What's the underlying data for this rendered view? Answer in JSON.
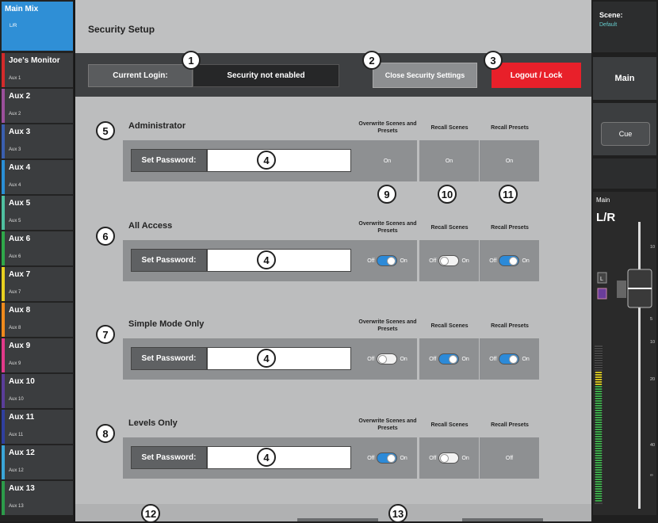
{
  "sidebar": {
    "header": {
      "title": "Main Mix",
      "subtitle": "L/R"
    },
    "items": [
      {
        "name": "Joe's Monitor",
        "sub": "Aux 1",
        "color": "#d42b2b"
      },
      {
        "name": "Aux 2",
        "sub": "Aux 2",
        "color": "#9b4f9b"
      },
      {
        "name": "Aux 3",
        "sub": "Aux 3",
        "color": "#3a5fb0"
      },
      {
        "name": "Aux 4",
        "sub": "Aux 4",
        "color": "#2a8fd6"
      },
      {
        "name": "Aux 5",
        "sub": "Aux 5",
        "color": "#4fc0a0"
      },
      {
        "name": "Aux 6",
        "sub": "Aux 6",
        "color": "#2fa84a"
      },
      {
        "name": "Aux 7",
        "sub": "Aux 7",
        "color": "#e8d020"
      },
      {
        "name": "Aux 8",
        "sub": "Aux 8",
        "color": "#f08a1c"
      },
      {
        "name": "Aux 9",
        "sub": "Aux 9",
        "color": "#e23a8a"
      },
      {
        "name": "Aux 10",
        "sub": "Aux 10",
        "color": "#5a3d9a"
      },
      {
        "name": "Aux 11",
        "sub": "Aux 11",
        "color": "#2f3f9f"
      },
      {
        "name": "Aux 12",
        "sub": "Aux 12",
        "color": "#3aa6d8"
      },
      {
        "name": "Aux 13",
        "sub": "Aux 13",
        "color": "#2c9b4a"
      }
    ]
  },
  "header": {
    "title": "Security Setup"
  },
  "login": {
    "label": "Current Login:",
    "value": "Security not enabled",
    "close_button": "Close Security Settings",
    "logout_button": "Logout / Lock"
  },
  "columns": [
    "Overwrite Scenes and Presets",
    "Recall Scenes",
    "Recall Presets"
  ],
  "sections": [
    {
      "title": "Administrator",
      "password_label": "Set Password:",
      "perms": [
        {
          "type": "text",
          "value": "On"
        },
        {
          "type": "text",
          "value": "On"
        },
        {
          "type": "text",
          "value": "On"
        }
      ]
    },
    {
      "title": "All Access",
      "password_label": "Set Password:",
      "perms": [
        {
          "type": "toggle",
          "state": "on"
        },
        {
          "type": "toggle",
          "state": "off"
        },
        {
          "type": "toggle",
          "state": "on"
        }
      ]
    },
    {
      "title": "Simple Mode Only",
      "password_label": "Set Password:",
      "perms": [
        {
          "type": "toggle",
          "state": "off"
        },
        {
          "type": "toggle",
          "state": "on"
        },
        {
          "type": "toggle",
          "state": "on"
        }
      ]
    },
    {
      "title": "Levels Only",
      "password_label": "Set Password:",
      "perms": [
        {
          "type": "toggle",
          "state": "on"
        },
        {
          "type": "toggle",
          "state": "off"
        },
        {
          "type": "text",
          "value": "Off"
        }
      ]
    }
  ],
  "toggle_labels": {
    "off": "Off",
    "on": "On"
  },
  "callouts": {
    "c1": "1",
    "c2": "2",
    "c3": "3",
    "c4": "4",
    "c5": "5",
    "c6": "6",
    "c7": "7",
    "c8": "8",
    "c9": "9",
    "c10": "10",
    "c11": "11",
    "c12": "12",
    "c13": "13"
  },
  "right": {
    "scene_label": "Scene:",
    "scene_value": "Default",
    "main_button": "Main",
    "cue_button": "Cue",
    "strip_name": "Main",
    "strip_channel": "L/R",
    "strip_badge": "L",
    "meter_marks": [
      "10",
      "5",
      "10",
      "20",
      "40",
      "∞"
    ]
  },
  "colors": {
    "accent": "#2f8fd6",
    "logout": "#e8202a",
    "toggle_on": "#2c8ad8"
  }
}
